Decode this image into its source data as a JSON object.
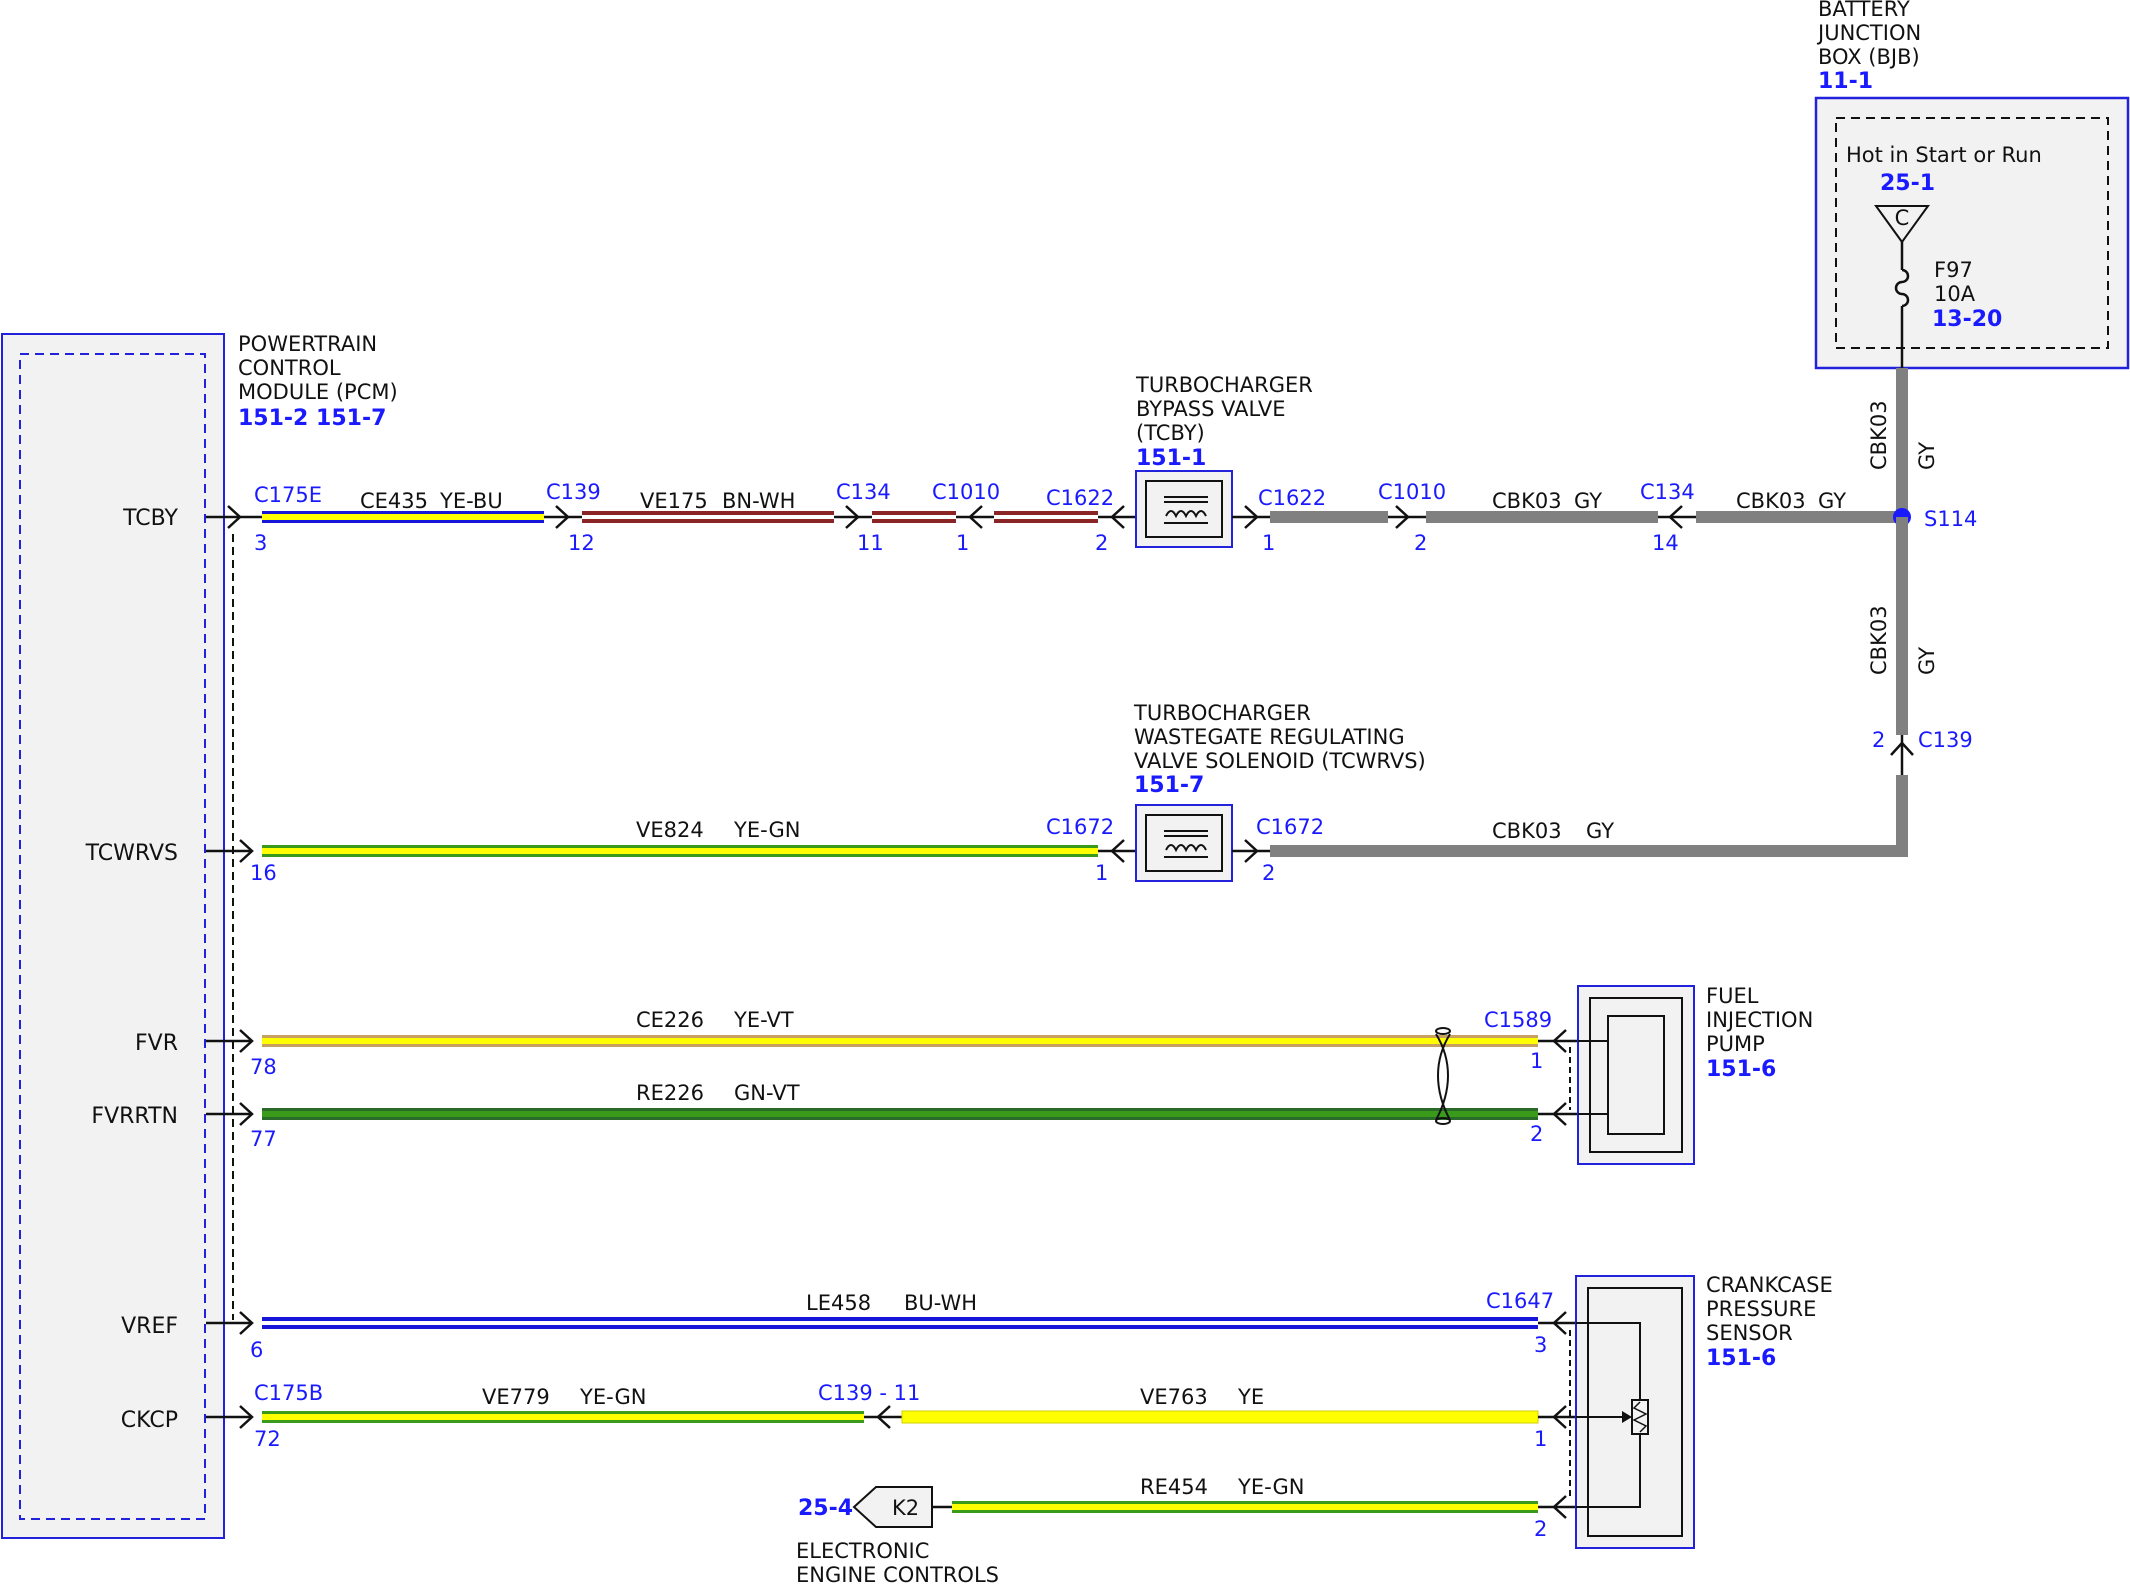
{
  "colors": {
    "blue": "#1a1aff",
    "frame": "#2222dd",
    "box_fill": "#f2f2f2",
    "YE": "#ffff00",
    "BU": "#1616d8",
    "BN": "#8b2424",
    "WH": "#ffffff",
    "GN": "#3a9a1a",
    "VT": "#c8a060",
    "GY": "#808080",
    "DKGN": "#2a6a2a"
  },
  "pcm": {
    "title_lines": [
      "POWERTRAIN",
      "CONTROL",
      "MODULE (PCM)"
    ],
    "refs": "151-2 151-7",
    "pins": [
      {
        "signal": "TCBY",
        "pin": "3"
      },
      {
        "signal": "TCWRVS",
        "pin": "16"
      },
      {
        "signal": "FVR",
        "pin": "78"
      },
      {
        "signal": "FVRRTN",
        "pin": "77"
      },
      {
        "signal": "VREF",
        "pin": "6"
      },
      {
        "signal": "CKCP",
        "pin": "72"
      }
    ]
  },
  "bjb": {
    "title_lines": [
      "BATTERY",
      "JUNCTION",
      "BOX (BJB)"
    ],
    "ref": "11-1",
    "hot_label": "Hot in Start or Run",
    "hot_ref": "25-1",
    "connector_letter": "C",
    "fuse": "F97",
    "fuse_rating": "10A",
    "fuse_ref": "13-20"
  },
  "tcby_valve": {
    "title_lines": [
      "TURBOCHARGER",
      "BYPASS VALVE",
      "(TCBY)"
    ],
    "ref": "151-1"
  },
  "tcwrvs_valve": {
    "title_lines": [
      "TURBOCHARGER",
      "WASTEGATE REGULATING",
      "VALVE SOLENOID (TCWRVS)"
    ],
    "ref": "151-7"
  },
  "fuel_pump": {
    "title_lines": [
      "FUEL",
      "INJECTION",
      "PUMP"
    ],
    "ref": "151-6"
  },
  "crankcase_sensor": {
    "title_lines": [
      "CRANKCASE",
      "PRESSURE",
      "SENSOR"
    ],
    "ref": "151-6"
  },
  "electronic_controls": {
    "title_lines": [
      "ELECTRONIC",
      "ENGINE CONTROLS"
    ],
    "ref": "25-4",
    "connector": "K2"
  },
  "splice": "S114",
  "connectors": {
    "c175e": "C175E",
    "c175e_pin": "3",
    "c139_a": "C139",
    "c139_a_pin": "12",
    "c134_a": "C134",
    "c134_a_pin": "11",
    "c1010_a": "C1010",
    "c1010_a_pin": "1",
    "c1622_a": "C1622",
    "c1622_a_pin": "2",
    "c1622_b": "C1622",
    "c1622_b_pin": "1",
    "c1010_b": "C1010",
    "c1010_b_pin": "2",
    "c134_b": "C134",
    "c134_b_pin": "14",
    "c139_b": "C139",
    "c139_b_pin": "2",
    "c1672_a": "C1672",
    "c1672_a_pin": "1",
    "c1672_b": "C1672",
    "c1672_b_pin": "2",
    "c1589": "C1589",
    "c1589_pin1": "1",
    "c1589_pin2": "2",
    "c1647": "C1647",
    "c1647_pin3": "3",
    "c1647_pin1": "1",
    "c1647_pin2": "2",
    "c175b": "C175B",
    "c139_c": "C139 - 11"
  },
  "wires": {
    "ce435": {
      "circuit": "CE435",
      "color": "YE-BU"
    },
    "ve175": {
      "circuit": "VE175",
      "color": "BN-WH"
    },
    "cbk03_a": {
      "circuit": "CBK03",
      "color": "GY"
    },
    "cbk03_b": {
      "circuit": "CBK03",
      "color": "GY"
    },
    "cbk03_v1": {
      "circuit": "CBK03",
      "color": "GY"
    },
    "cbk03_v2": {
      "circuit": "CBK03",
      "color": "GY"
    },
    "ve824": {
      "circuit": "VE824",
      "color": "YE-GN"
    },
    "cbk03_c": {
      "circuit": "CBK03",
      "color": "GY"
    },
    "ce226": {
      "circuit": "CE226",
      "color": "YE-VT"
    },
    "re226": {
      "circuit": "RE226",
      "color": "GN-VT"
    },
    "le458": {
      "circuit": "LE458",
      "color": "BU-WH"
    },
    "ve779": {
      "circuit": "VE779",
      "color": "YE-GN"
    },
    "ve763": {
      "circuit": "VE763",
      "color": "YE"
    },
    "re454": {
      "circuit": "RE454",
      "color": "YE-GN"
    }
  }
}
